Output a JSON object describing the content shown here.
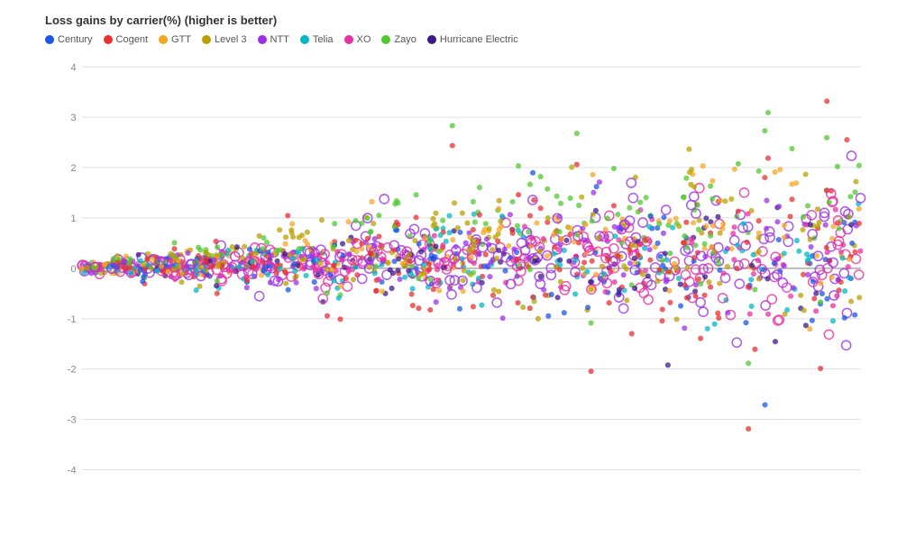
{
  "chart": {
    "title": "Loss gains by carrier(%) (higher is better)",
    "yAxis": {
      "min": -4,
      "max": 4,
      "ticks": [
        4,
        3,
        2,
        1,
        0,
        -1,
        -2,
        -3,
        -4
      ]
    },
    "legend": [
      {
        "name": "Century",
        "color": "#1a56e8"
      },
      {
        "name": "Cogent",
        "color": "#e83030"
      },
      {
        "name": "GTT",
        "color": "#f5a623"
      },
      {
        "name": "Level 3",
        "color": "#b8a000"
      },
      {
        "name": "NTT",
        "color": "#9b30e8"
      },
      {
        "name": "Telia",
        "color": "#00b8c8"
      },
      {
        "name": "XO",
        "color": "#e830a0"
      },
      {
        "name": "Zayo",
        "color": "#50c830"
      },
      {
        "name": "Hurricane Electric",
        "color": "#3b1a8c"
      }
    ]
  }
}
